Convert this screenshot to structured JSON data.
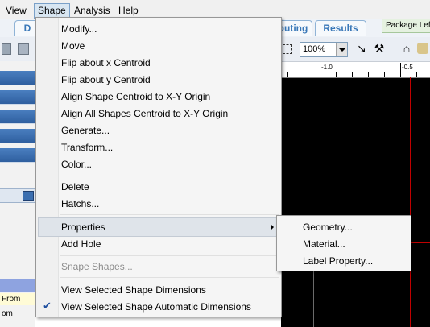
{
  "menubar": {
    "items": [
      "View",
      "Shape",
      "Analysis",
      "Help"
    ],
    "active": "Shape"
  },
  "tabs": [
    "D",
    "outing",
    "Results"
  ],
  "package_tab": "Package Left",
  "toolbar": {
    "zoom_value": "100%"
  },
  "ruler": {
    "labels": [
      "-1.0",
      "-0.5"
    ]
  },
  "left_panel": {
    "from_label": "From",
    "om_label": "om"
  },
  "menu": {
    "items": [
      "Modify...",
      "Move",
      "Flip about x Centroid",
      "Flip about y Centroid",
      "Align  Shape Centroid to X-Y Origin",
      "Align  All Shapes Centroid to X-Y Origin",
      "Generate...",
      "Transform...",
      "Color...",
      "Delete",
      "Hatchs...",
      "Properties",
      "Add Hole",
      "Snape Shapes...",
      "View Selected Shape Dimensions",
      "View Selected Shape Automatic Dimensions"
    ],
    "highlighted": "Properties",
    "disabled": [
      "Snape Shapes..."
    ],
    "checked": [
      "View Selected Shape Automatic Dimensions"
    ]
  },
  "submenu": {
    "items": [
      "Geometry...",
      "Material...",
      "Label Property..."
    ]
  },
  "colors": {
    "menu_bg": "#f5f5f5",
    "highlight": "#dfe4ea",
    "tab_text": "#3a78b8",
    "canvas": "#000000",
    "axis_red": "#c00000"
  }
}
